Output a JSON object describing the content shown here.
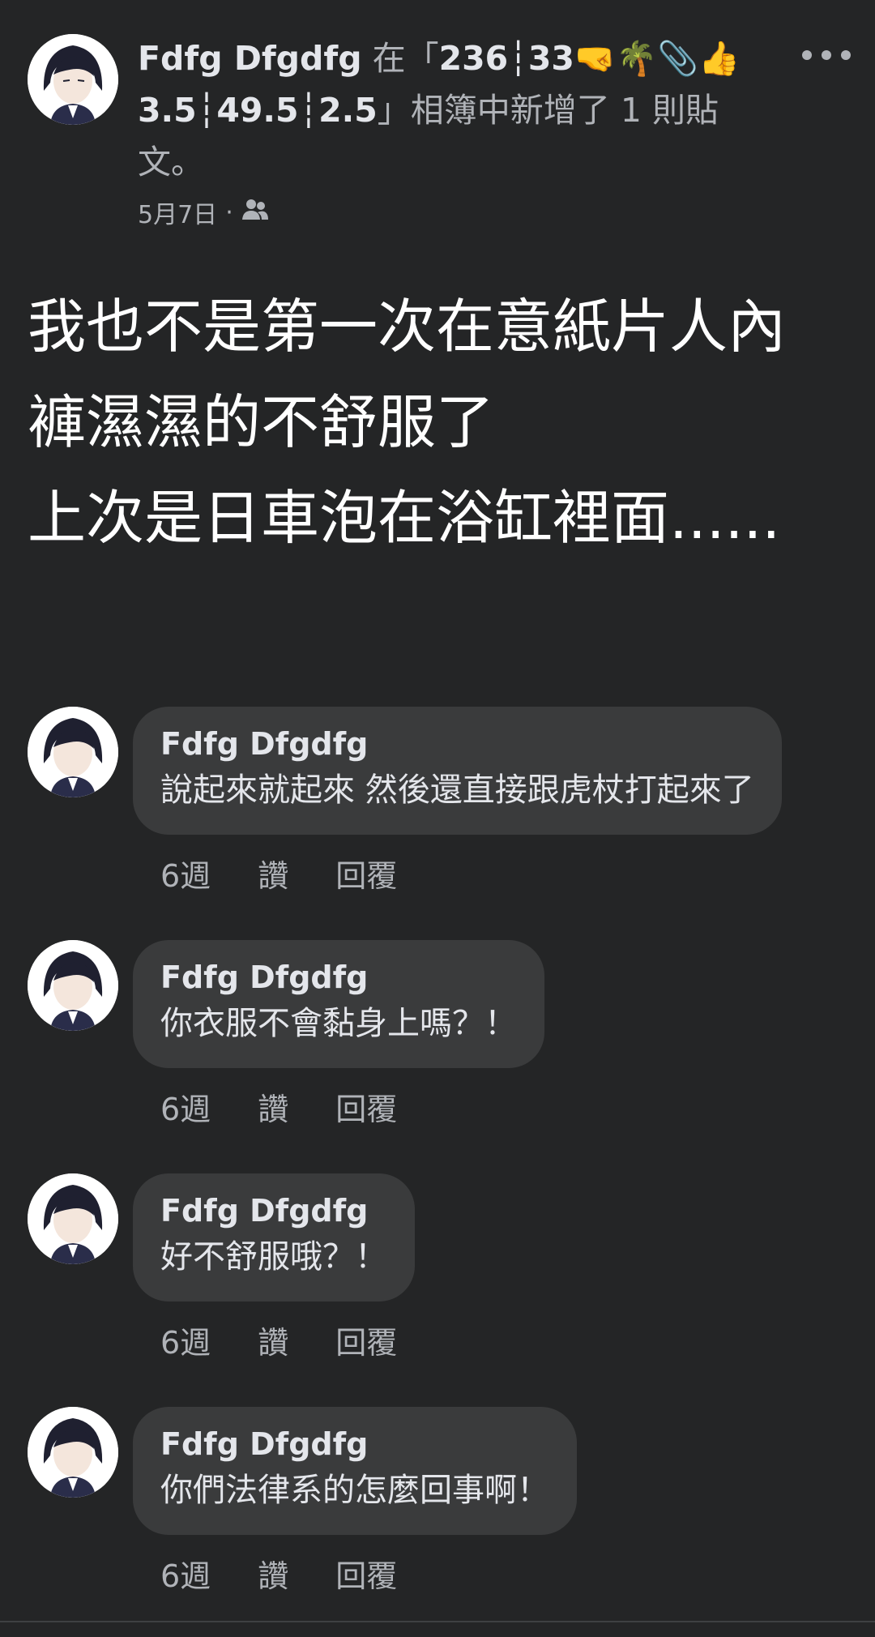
{
  "post": {
    "author": "Fdfg Dfgdfg",
    "action_prefix": "在「",
    "album_name": "236┆33🤜🌴📎👍 3.5┆49.5┆2.5",
    "action_suffix": "」相簿中新增了 1 則貼文。",
    "date": "5月7日",
    "meta_separator": "·",
    "audience_icon": "friends-icon",
    "body_lines": [
      "我也不是第一次在意紙片人內",
      "褲濕濕的不舒服了",
      "上次是日車泡在浴缸裡面......"
    ]
  },
  "comments": [
    {
      "author": "Fdfg Dfgdfg",
      "text": "說起來就起來 然後還直接跟虎杖打起來了",
      "time": "6週",
      "like_label": "讚",
      "reply_label": "回覆"
    },
    {
      "author": "Fdfg Dfgdfg",
      "text": "你衣服不會黏身上嗎？！",
      "time": "6週",
      "like_label": "讚",
      "reply_label": "回覆"
    },
    {
      "author": "Fdfg Dfgdfg",
      "text": "好不舒服哦？！",
      "time": "6週",
      "like_label": "讚",
      "reply_label": "回覆"
    },
    {
      "author": "Fdfg Dfgdfg",
      "text": "你們法律系的怎麼回事啊！",
      "time": "6週",
      "like_label": "讚",
      "reply_label": "回覆"
    }
  ],
  "colors": {
    "background": "#242526",
    "bubble": "#3a3b3c",
    "primary_text": "#e4e6eb",
    "secondary_text": "#b0b3b8"
  }
}
